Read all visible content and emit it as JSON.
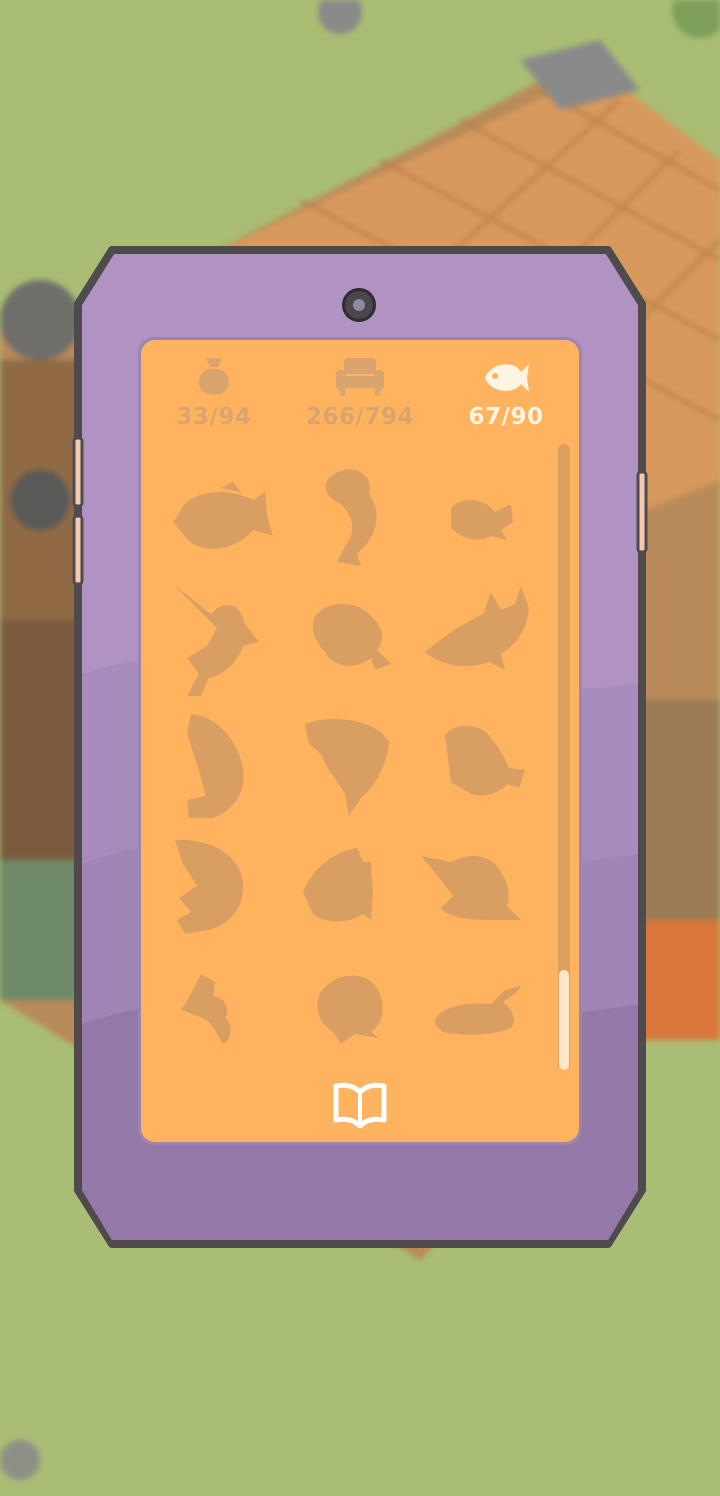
{
  "tabs": [
    {
      "name": "items",
      "icon": "pouch-icon",
      "count": "33/94",
      "active": false
    },
    {
      "name": "furniture",
      "icon": "sofa-icon",
      "count": "266/794",
      "active": false
    },
    {
      "name": "fish",
      "icon": "fish-icon",
      "count": "67/90",
      "active": true
    }
  ],
  "collection": {
    "cells": [
      "locked-fish-1",
      "locked-fish-2",
      "locked-fish-3",
      "locked-fish-4",
      "locked-fish-5",
      "locked-fish-6",
      "locked-fish-7",
      "locked-fish-8",
      "locked-fish-9",
      "locked-fish-10",
      "locked-fish-11",
      "locked-fish-12",
      "locked-fish-13",
      "locked-fish-14",
      "locked-fish-15"
    ],
    "scroll_position": 1.0
  },
  "footer": {
    "icon": "book-icon"
  },
  "colors": {
    "phone_body": "#b093c3",
    "phone_outline": "#4f4b4d",
    "screen": "#ffb35e",
    "silhouette": "#d99f62",
    "active_tab": "#fff4e2",
    "inactive_tab": "#d9a46e",
    "grass": "#a9bd74"
  }
}
